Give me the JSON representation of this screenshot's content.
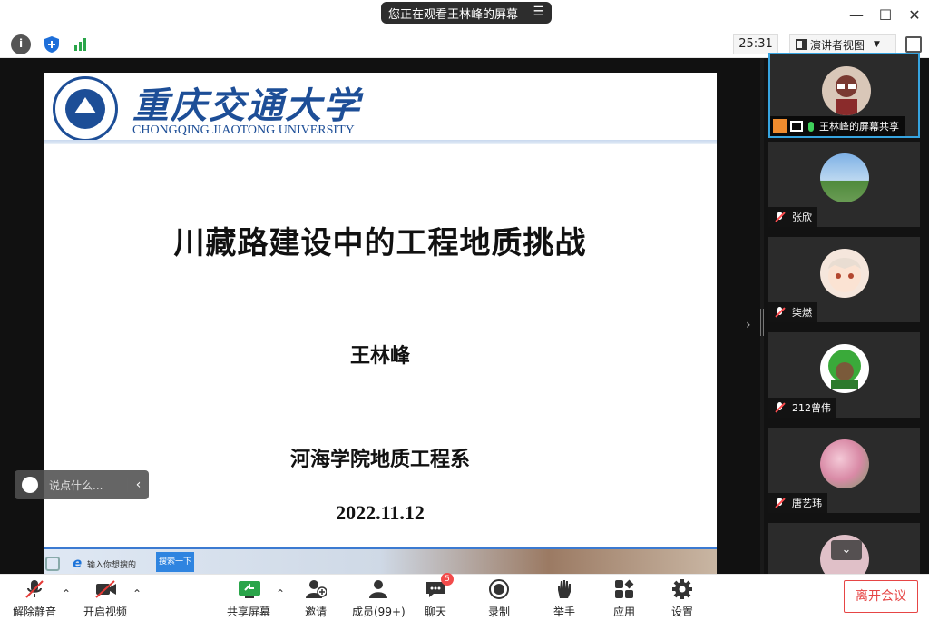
{
  "titlebar": {
    "sharing_notice": "您正在观看王林峰的屏幕",
    "menu_icon": "list-icon",
    "minimize": "—",
    "maximize": "☐",
    "close": "✕"
  },
  "infobar": {
    "timer": "25:31",
    "view_label": "演讲者视图",
    "icons": [
      "info-icon",
      "shield-icon",
      "signal-icon"
    ]
  },
  "slide": {
    "university_cn": "重庆交通大学",
    "university_en": "CHONGQING JIAOTONG UNIVERSITY",
    "title": "川藏路建设中的工程地质挑战",
    "author": "王林峰",
    "department": "河海学院地质工程系",
    "date": "2022.11.12",
    "footer_search_placeholder": "输入你想搜的",
    "footer_search_button": "搜索一下"
  },
  "chat_input": {
    "placeholder": "说点什么..."
  },
  "participants": [
    {
      "name": "王林峰的屏幕共享",
      "avatar_color": "#d9c7b8",
      "active": true
    },
    {
      "name": "张欣",
      "avatar_color": "#6fa1d6",
      "active": false
    },
    {
      "name": "柒燃",
      "avatar_color": "#f3d9c9",
      "active": false
    },
    {
      "name": "212曾伟",
      "avatar_color": "#3aaa3a",
      "active": false
    },
    {
      "name": "唐艺玮",
      "avatar_color": "#e8b8c8",
      "active": false
    },
    {
      "name": "",
      "avatar_color": "#e0c0c8",
      "active": false
    }
  ],
  "toolbar": {
    "unmute": "解除静音",
    "start_video": "开启视频",
    "share_screen": "共享屏幕",
    "invite": "邀请",
    "members": "成员(99+)",
    "chat": "聊天",
    "chat_badge": "5",
    "record": "录制",
    "raise_hand": "举手",
    "apps": "应用",
    "settings": "设置",
    "leave": "离开会议"
  },
  "colors": {
    "accent_blue": "#1d4e97",
    "leave_red": "#e64545",
    "active_border": "#36a4e0",
    "share_green": "#2aa54a"
  }
}
